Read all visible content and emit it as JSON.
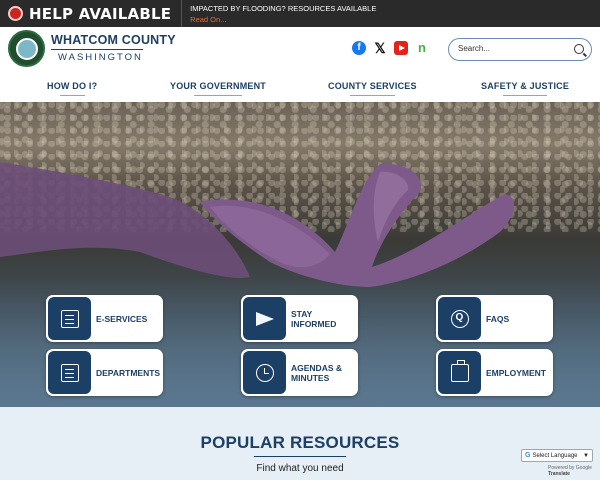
{
  "alert": {
    "title": "HELP AVAILABLE",
    "message": "IMPACTED BY FLOODING? RESOURCES AVAILABLE",
    "link": "Read On..."
  },
  "header": {
    "logo_title": "WHATCOM COUNTY",
    "logo_sub": "WASHINGTON",
    "search_placeholder": "Search..."
  },
  "social": [
    {
      "name": "facebook",
      "icon": "facebook-icon",
      "glyph": "f",
      "color": "#1877f2"
    },
    {
      "name": "x",
      "icon": "x-icon",
      "glyph": "𝕏",
      "color": "#111111"
    },
    {
      "name": "youtube",
      "icon": "youtube-icon",
      "color": "#e62117"
    },
    {
      "name": "nextdoor",
      "icon": "nextdoor-icon",
      "glyph": "n",
      "color": "#3dbb3a"
    }
  ],
  "nav": {
    "items": [
      "HOW DO I?",
      "YOUR GOVERNMENT",
      "COUNTY SERVICES",
      "SAFETY & JUSTICE"
    ]
  },
  "quick_links": [
    {
      "label": "E-SERVICES",
      "icon": "document-icon"
    },
    {
      "label": "STAY INFORMED",
      "icon": "paper-plane-icon"
    },
    {
      "label": "FAQS",
      "icon": "chat-bubbles-icon"
    },
    {
      "label": "DEPARTMENTS",
      "icon": "clipboard-icon"
    },
    {
      "label": "AGENDAS & MINUTES",
      "icon": "calendar-clock-icon"
    },
    {
      "label": "EMPLOYMENT",
      "icon": "briefcase-icon"
    }
  ],
  "popular": {
    "title": "POPULAR RESOURCES",
    "subtitle": "Find what you need"
  },
  "translate": {
    "select_label": "Select Language",
    "powered_by": "Powered by",
    "google": "Google",
    "translate": "Translate"
  },
  "colors": {
    "brand_navy": "#1c3f66",
    "alert_red": "#c8261f",
    "alert_link": "#e76b3e",
    "alert_bg": "#2a2a2a"
  }
}
